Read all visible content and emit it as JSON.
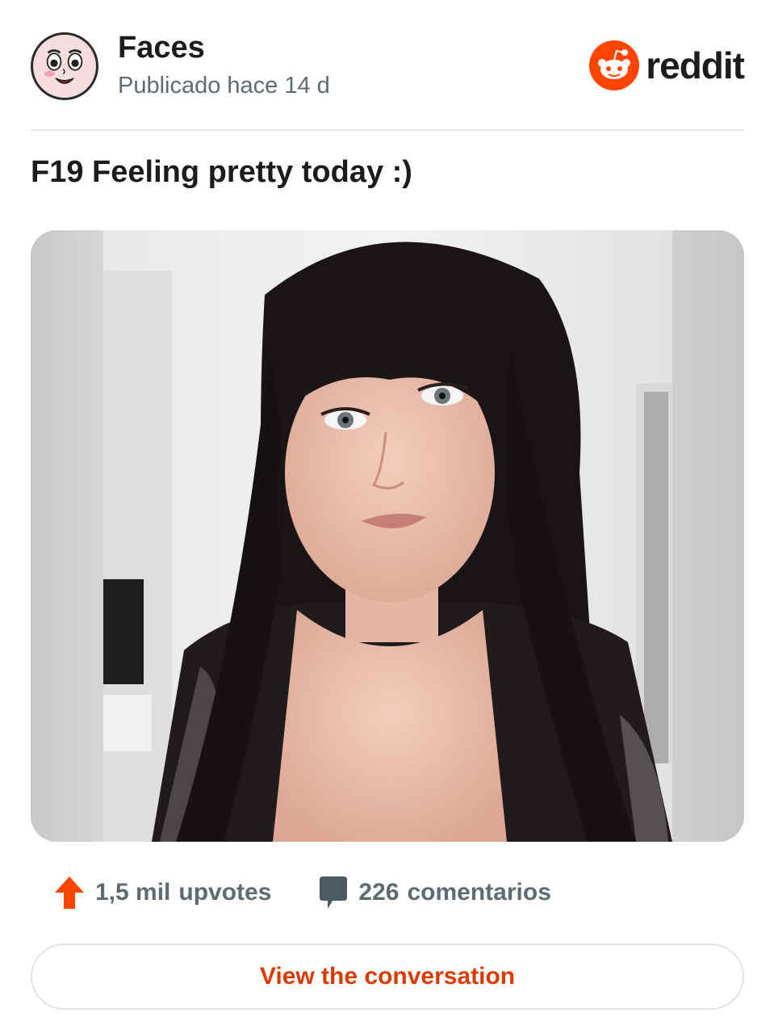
{
  "post": {
    "subreddit": "Faces",
    "posted": "Publicado hace 14 d",
    "title": "F19 Feeling pretty today :)",
    "image_alt": "selfie photo"
  },
  "brand": {
    "wordmark": "reddit",
    "accent": "#ff4500",
    "logo_icon": "reddit-snoo-icon"
  },
  "stats": {
    "upvotes_count": "1,5 mil",
    "upvotes_label": "upvotes",
    "comments_count": "226",
    "comments_label": "comentarios"
  },
  "actions": {
    "view_conversation": "View the conversation"
  },
  "colors": {
    "upvote": "#ff4500",
    "cta_text": "#d93a00",
    "muted_text": "#5f6b73"
  }
}
